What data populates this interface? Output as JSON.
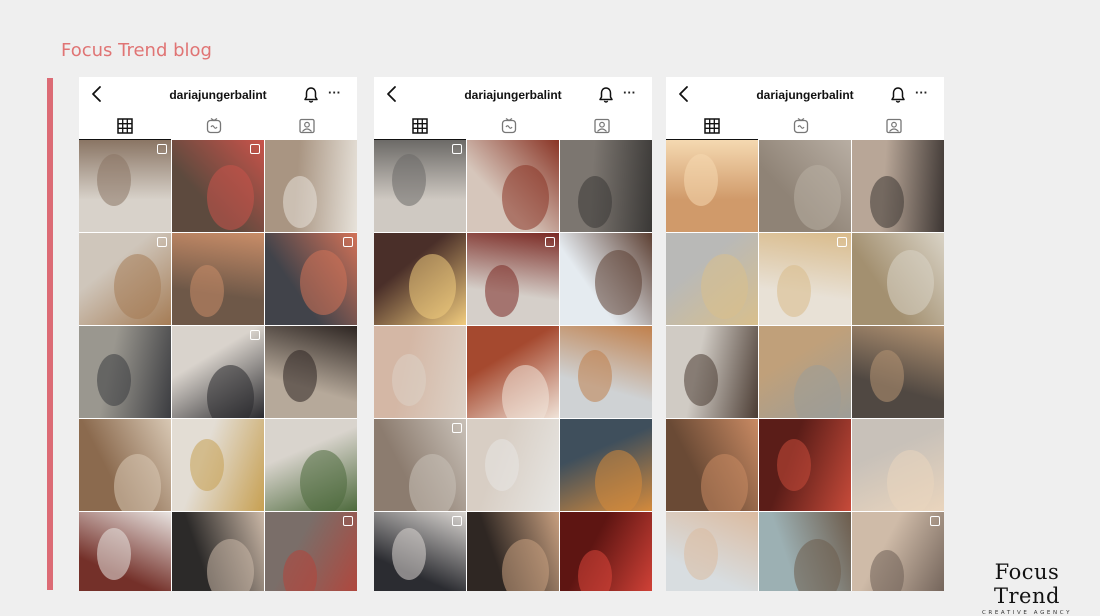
{
  "page": {
    "title": "Focus Trend blog",
    "accent_color": "#dc6b75"
  },
  "logo": {
    "name": "Focus Trend",
    "tagline": "CREATIVE AGENCY"
  },
  "profiles": [
    {
      "username": "dariajungerbalint",
      "back_icon": "chevron-left-icon",
      "bell_icon": "bell-icon",
      "more_label": "···",
      "tabs": [
        "grid-icon",
        "reels-icon",
        "tagged-icon"
      ],
      "active_tab": 0,
      "tiles": [
        [
          "#d8d2ca",
          "#8a7564",
          true
        ],
        [
          "#5d4a3e",
          "#c9534a",
          true
        ],
        [
          "#a99582",
          "#e7e2da",
          false
        ],
        [
          "#cfc6bb",
          "#a57c55",
          true
        ],
        [
          "#6e5848",
          "#c98d68",
          false
        ],
        [
          "#41434a",
          "#d27258",
          true
        ],
        [
          "#9a978f",
          "#3b3c40",
          false
        ],
        [
          "#d9d3cc",
          "#2a2a2e",
          true
        ],
        [
          "#b6a99a",
          "#2d2522",
          false
        ],
        [
          "#8b6a4e",
          "#d8c8b4",
          false
        ],
        [
          "#e3ddd4",
          "#c7a052",
          false
        ],
        [
          "#d9d4cd",
          "#4d6a3c",
          false
        ],
        [
          "#743029",
          "#e8e3e0",
          false
        ],
        [
          "#2c2a29",
          "#cbb8a7",
          false
        ],
        [
          "#7a6e69",
          "#b4443a",
          true
        ]
      ]
    },
    {
      "username": "dariajungerbalint",
      "back_icon": "chevron-left-icon",
      "bell_icon": "bell-icon",
      "more_label": "···",
      "tabs": [
        "grid-icon",
        "reels-icon",
        "tagged-icon"
      ],
      "active_tab": 0,
      "tiles": [
        [
          "#cfc9c2",
          "#6c6a67",
          true
        ],
        [
          "#d6c6bb",
          "#8a3526",
          false
        ],
        [
          "#7c7670",
          "#3a3836",
          false
        ],
        [
          "#4a2f29",
          "#f1cc7e",
          false
        ],
        [
          "#d5cfc9",
          "#7b2a24",
          true
        ],
        [
          "#e5ebf0",
          "#5d4033",
          false
        ],
        [
          "#d4b7a5",
          "#ddd2c7",
          false
        ],
        [
          "#a5492f",
          "#f0e3d8",
          false
        ],
        [
          "#cfd2d4",
          "#c0804c",
          false
        ],
        [
          "#8c7c6f",
          "#c9c1b8",
          true
        ],
        [
          "#d8cec4",
          "#e7e6e3",
          false
        ],
        [
          "#3f4f5c",
          "#d48a3c",
          false
        ],
        [
          "#2b2c31",
          "#dad6d2",
          true
        ],
        [
          "#2f2723",
          "#c8a080",
          false
        ],
        [
          "#5e1512",
          "#d9453a",
          false
        ]
      ]
    },
    {
      "username": "dariajungerbalint",
      "back_icon": "chevron-left-icon",
      "bell_icon": "bell-icon",
      "more_label": "···",
      "tabs": [
        "grid-icon",
        "reels-icon",
        "tagged-icon"
      ],
      "active_tab": 0,
      "tiles": [
        [
          "#d09a6a",
          "#f5d9b1",
          false
        ],
        [
          "#8f8376",
          "#b8aea3",
          false
        ],
        [
          "#b8a697",
          "#3d3633",
          false
        ],
        [
          "#b9b9b7",
          "#d8bf8c",
          false
        ],
        [
          "#e8e1d6",
          "#d9bb8b",
          true
        ],
        [
          "#a39070",
          "#d9d3c6",
          false
        ],
        [
          "#d0cbc4",
          "#4b3c33",
          false
        ],
        [
          "#c0a07a",
          "#9d9d97",
          false
        ],
        [
          "#504842",
          "#b49473",
          false
        ],
        [
          "#6a4a35",
          "#c98a63",
          false
        ],
        [
          "#5b1d18",
          "#c74b3a",
          false
        ],
        [
          "#c8c1b9",
          "#ead5bd",
          false
        ],
        [
          "#d8dde0",
          "#dbbba0",
          false
        ],
        [
          "#9cb0b3",
          "#6d5c4c",
          false
        ],
        [
          "#cfbba8",
          "#6d5e55",
          true
        ]
      ]
    }
  ]
}
